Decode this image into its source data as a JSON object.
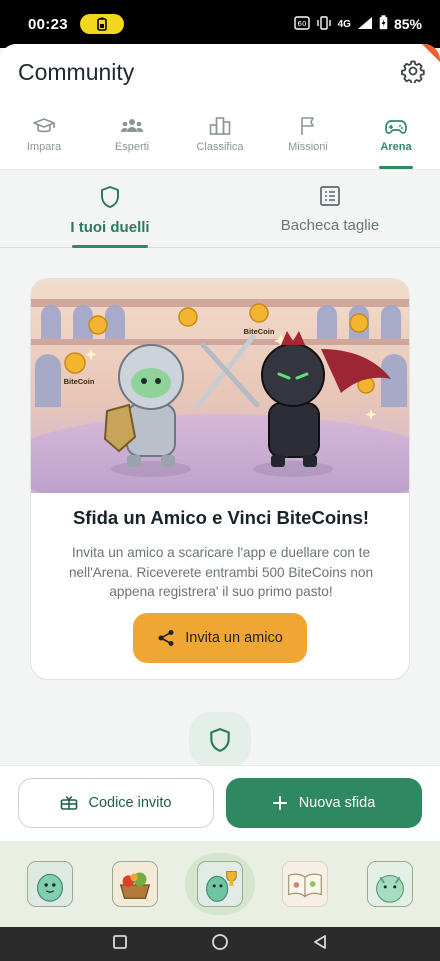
{
  "status_bar": {
    "time": "00:23",
    "network": "4G",
    "battery_pct": "85%"
  },
  "header": {
    "title": "Community"
  },
  "top_tabs": [
    {
      "label": "Impara",
      "icon": "graduation-cap-icon",
      "active": false
    },
    {
      "label": "Esperti",
      "icon": "group-icon",
      "active": false
    },
    {
      "label": "Classifica",
      "icon": "leaderboard-icon",
      "active": false
    },
    {
      "label": "Missioni",
      "icon": "flag-icon",
      "active": false
    },
    {
      "label": "Arena",
      "icon": "gamepad-icon",
      "active": true
    }
  ],
  "sub_tabs": [
    {
      "label": "I tuoi duelli",
      "icon": "shield-icon",
      "active": true
    },
    {
      "label": "Bacheca taglie",
      "icon": "list-board-icon",
      "active": false
    }
  ],
  "promo": {
    "coin_label_1": "BiteCoin",
    "coin_label_2": "BiteCoin",
    "title": "Sfida un Amico e Vinci BiteCoins!",
    "text": "Invita un amico a scaricare l'app e duellare con te nell'Arena. Riceverete entrambi 500 BiteCoins non appena registrera' il suo primo pasto!",
    "button": "Invita un amico"
  },
  "actions": {
    "invite_code": "Codice invito",
    "new_challenge": "Nuova sfida"
  },
  "colors": {
    "primary": "#2e8861",
    "accent": "#f0a633"
  }
}
